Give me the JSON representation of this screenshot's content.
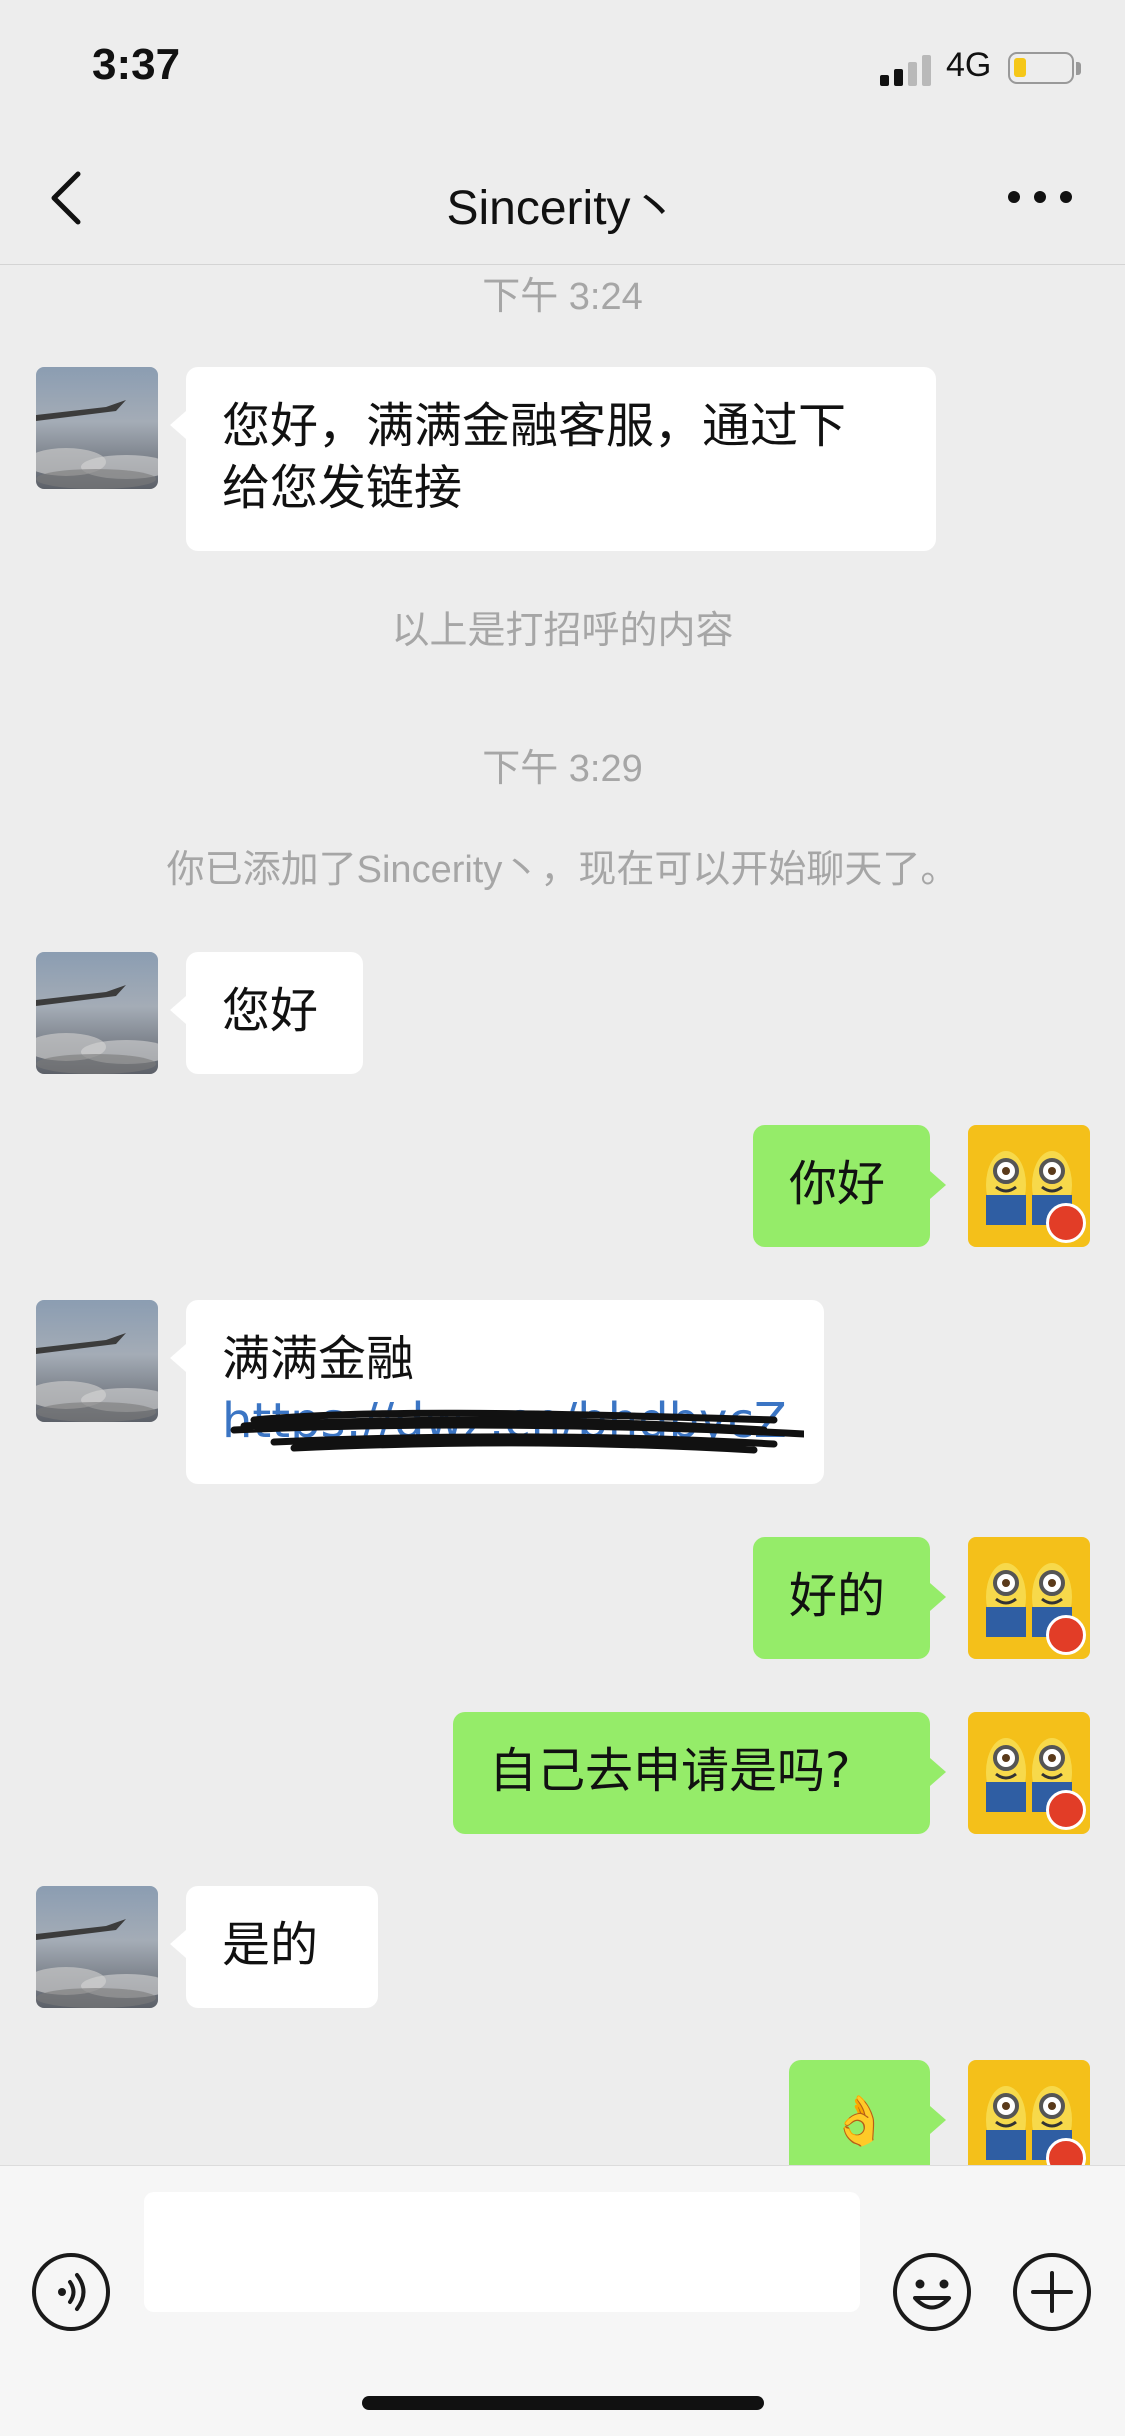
{
  "status_bar": {
    "time": "3:37",
    "network": "4G",
    "battery_fill": 0.2
  },
  "nav": {
    "title": "Sincerity丶",
    "back_icon": "chevron-left-icon",
    "more_icon": "more-dots-icon"
  },
  "messages": {
    "ts1": "下午 3:24",
    "m1": {
      "line1": "您好，满满金融客服，通过下",
      "line2": "给您发链接"
    },
    "sys1": "以上是打招呼的内容",
    "ts2": "下午 3:29",
    "sys2": "你已添加了Sincerity丶，现在可以开始聊天了。",
    "m2": "您好",
    "m3": "你好",
    "m4": {
      "title": "满满金融",
      "link": "https://dwz.cn/bhdbycZ"
    },
    "m5": "好的",
    "m6": "自己去申请是吗?",
    "m7": "是的",
    "m8": "👌"
  },
  "input_bar": {
    "placeholder": "",
    "icons": {
      "voice": "voice-icon",
      "emoji": "emoji-icon",
      "plus": "plus-icon"
    }
  },
  "colors": {
    "background": "#ededed",
    "incoming_bubble": "#ffffff",
    "outgoing_bubble": "#95ec69",
    "link": "#3b75c4",
    "timestamp": "#a6a6a6"
  }
}
